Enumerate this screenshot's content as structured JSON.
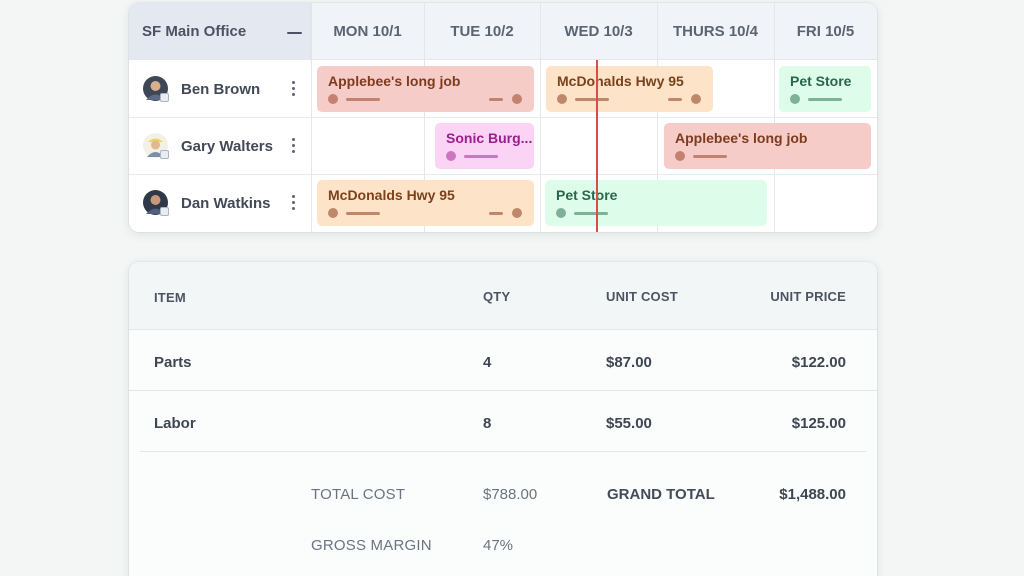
{
  "schedule": {
    "office": "SF Main Office",
    "days": [
      "MON 10/1",
      "TUE 10/2",
      "WED 10/3",
      "THURS 10/4",
      "FRI 10/5"
    ],
    "technicians": [
      {
        "name": "Ben Brown"
      },
      {
        "name": "Gary Walters"
      },
      {
        "name": "Dan Watkins"
      }
    ],
    "jobs": [
      {
        "title": "Applebee's long job",
        "color": "#f5ccc8"
      },
      {
        "title": "McDonalds Hwy 95",
        "color": "#fde3c8"
      },
      {
        "title": "Pet Store",
        "color": "#defcea"
      },
      {
        "title": "Sonic Burg...",
        "color": "#fbd3f4"
      },
      {
        "title": "Applebee's long job",
        "color": "#f5ccc8"
      },
      {
        "title": "McDonalds Hwy 95",
        "color": "#fde3c8"
      },
      {
        "title": "Pet Store",
        "color": "#defcea"
      }
    ],
    "now_indicator_color": "#e0494b"
  },
  "invoice": {
    "headers": {
      "item": "ITEM",
      "qty": "QTY",
      "unit_cost": "UNIT COST",
      "unit_price": "UNIT PRICE"
    },
    "rows": [
      {
        "item": "Parts",
        "qty": "4",
        "unit_cost": "$87.00",
        "unit_price": "$122.00"
      },
      {
        "item": "Labor",
        "qty": "8",
        "unit_cost": "$55.00",
        "unit_price": "$125.00"
      }
    ],
    "summary": {
      "total_cost_label": "TOTAL COST",
      "total_cost_value": "$788.00",
      "grand_total_label": "GRAND TOTAL",
      "grand_total_value": "$1,488.00",
      "gross_margin_label": "GROSS MARGIN",
      "gross_margin_value": "47%"
    }
  }
}
